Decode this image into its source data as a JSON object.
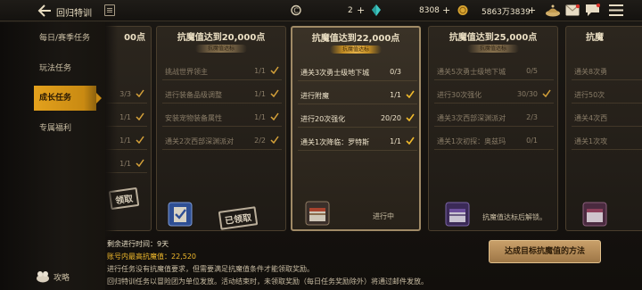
{
  "header": {
    "title": "回归特训",
    "currency1_value": "2",
    "currency2_value": "8308",
    "currency3_value": "5863万3839",
    "plus": "+"
  },
  "sidebar": {
    "items": [
      {
        "label": "每日/赛季任务"
      },
      {
        "label": "玩法任务"
      },
      {
        "label": "成长任务",
        "active": true
      },
      {
        "label": "专属福利"
      }
    ],
    "guide_label": "攻略"
  },
  "cards": [
    {
      "title": "00点",
      "rows": [
        {
          "text": "",
          "count": "3/3",
          "checked": true,
          "style": "dim"
        },
        {
          "text": "",
          "count": "1/1",
          "checked": true,
          "style": "dim"
        },
        {
          "text": "",
          "count": "1/1",
          "checked": true,
          "style": "dim"
        },
        {
          "text": "",
          "count": "1/1",
          "checked": true,
          "style": "dim"
        }
      ],
      "reward_status": "领取"
    },
    {
      "title": "抗魔值达到20,000点",
      "tag": "抗魔值达标",
      "rows": [
        {
          "text": "挑战世界领主",
          "count": "1/1",
          "checked": true,
          "style": "dim"
        },
        {
          "text": "进行装备品级调整",
          "count": "1/1",
          "checked": true,
          "style": "dim"
        },
        {
          "text": "安装宠物装备属性",
          "count": "1/1",
          "checked": true,
          "style": "dim"
        },
        {
          "text": "通关2次西部深渊派对",
          "count": "2/2",
          "checked": true,
          "style": "dim"
        }
      ],
      "reward_status": "已领取"
    },
    {
      "title": "抗魔值达到22,000点",
      "tag": "抗魔值达标",
      "rows": [
        {
          "text": "通关3次勇士级地下城",
          "count": "0/3",
          "checked": false,
          "style": "bright"
        },
        {
          "text": "进行附魔",
          "count": "1/1",
          "checked": true,
          "style": "bright"
        },
        {
          "text": "进行20次强化",
          "count": "20/20",
          "checked": true,
          "style": "bright"
        },
        {
          "text": "通关1次降临：罗特斯",
          "count": "1/1",
          "checked": true,
          "style": "bright"
        }
      ],
      "reward_status": "进行中"
    },
    {
      "title": "抗魔值达到25,000点",
      "tag": "抗魔值达标",
      "rows": [
        {
          "text": "通关5次勇士级地下城",
          "count": "0/5",
          "checked": false,
          "style": "dim"
        },
        {
          "text": "进行30次强化",
          "count": "30/30",
          "checked": true,
          "style": "dim"
        },
        {
          "text": "通关3次西部深渊派对",
          "count": "2/3",
          "checked": false,
          "style": "dim"
        },
        {
          "text": "通关1次初探：奥兹玛",
          "count": "0/1",
          "checked": false,
          "style": "dim"
        }
      ],
      "reward_status": "抗魔值达标后解锁。"
    },
    {
      "title": "抗魔",
      "rows": [
        {
          "text": "通关8次勇",
          "count": "",
          "checked": false,
          "style": "dim"
        },
        {
          "text": "进行50次",
          "count": "",
          "checked": false,
          "style": "dim"
        },
        {
          "text": "通关4次西",
          "count": "",
          "checked": false,
          "style": "dim"
        },
        {
          "text": "通关1次攻",
          "count": "",
          "checked": false,
          "style": "dim"
        }
      ],
      "reward_status": ""
    }
  ],
  "info": {
    "time_label": "剩余进行时间：",
    "time_value": "9天",
    "max_label": "账号内最高抗魔值：",
    "max_value": "22,520",
    "note1": "进行任务没有抗魔值要求，但需要满足抗魔值条件才能领取奖励。",
    "note2": "回归特训任务以冒险团为单位发放。活动结束时，未领取奖励（每日任务奖励除外）将通过邮件发放。"
  },
  "method_button": "达成目标抗魔值的方法",
  "colors": {
    "accent": "#e3a11d",
    "highlight": "#f0b92c",
    "bg": "#15120f"
  }
}
